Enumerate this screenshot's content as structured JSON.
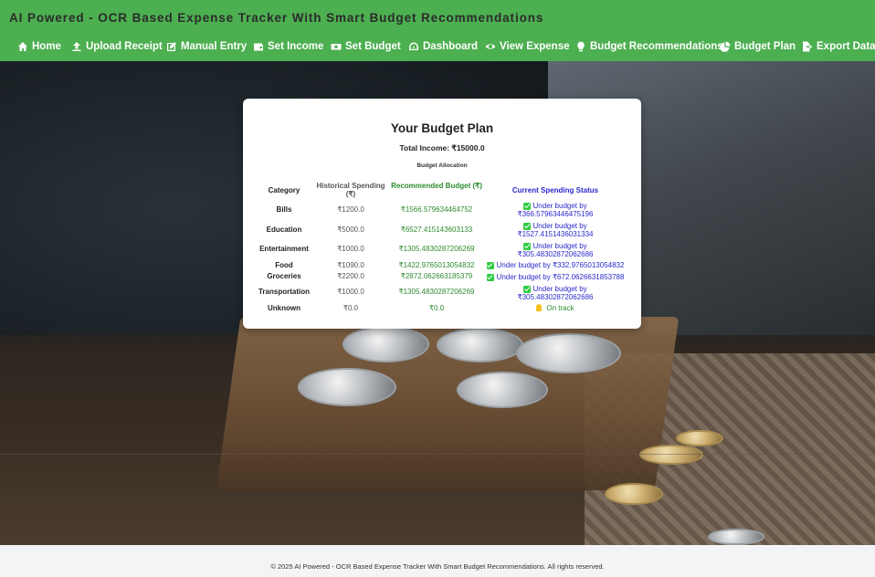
{
  "header": {
    "title": "AI Powered - OCR Based Expense Tracker With Smart Budget Recommendations",
    "nav": [
      {
        "label": "Home",
        "icon": "home-icon"
      },
      {
        "label": "Upload Receipt",
        "icon": "upload-icon"
      },
      {
        "label": "Manual Entry",
        "icon": "edit-icon"
      },
      {
        "label": "Set Income",
        "icon": "wallet-icon"
      },
      {
        "label": "Set Budget",
        "icon": "money-icon"
      },
      {
        "label": "Dashboard",
        "icon": "gauge-icon"
      },
      {
        "label": "View Expense",
        "icon": "eye-icon"
      },
      {
        "label": "Budget Recommendations",
        "icon": "lightbulb-icon"
      },
      {
        "label": "Budget Plan",
        "icon": "pie-chart-icon"
      },
      {
        "label": "Export Data",
        "icon": "file-export-icon"
      }
    ]
  },
  "card": {
    "title": "Your Budget Plan",
    "income": "Total Income: ₹15000.0",
    "allocation_label": "Budget Allocation",
    "columns": {
      "category": "Category",
      "historical": "Historical Spending (₹)",
      "recommended": "Recommended Budget (₹)",
      "status": "Current Spending Status"
    },
    "rows": [
      {
        "category": "Bills",
        "historical": "₹1200.0",
        "recommended": "₹1566.579634464752",
        "status": "Under budget by ₹366.57963446475196"
      },
      {
        "category": "Education",
        "historical": "₹5000.0",
        "recommended": "₹6527.415143603133",
        "status": "Under budget by ₹1527.4151436031334"
      },
      {
        "category": "Entertainment",
        "historical": "₹1000.0",
        "recommended": "₹1305.4830287206269",
        "status": "Under budget by ₹305.48302872062686"
      },
      {
        "category": "Food",
        "historical": "₹1090.0",
        "recommended": "₹1422.9765013054832",
        "status": "Under budget by ₹332.9765013054832"
      },
      {
        "category": "Groceries",
        "historical": "₹2200.0",
        "recommended": "₹2872.062663185379",
        "status": "Under budget by ₹672.0626631853788"
      },
      {
        "category": "Transportation",
        "historical": "₹1000.0",
        "recommended": "₹1305.4830287206269",
        "status": "Under budget by ₹305.48302872062686"
      },
      {
        "category": "Unknown",
        "historical": "₹0.0",
        "recommended": "₹0.0",
        "status": "On track"
      }
    ]
  },
  "footer": {
    "text": "© 2025 AI Powered - OCR Based Expense Tracker With Smart Budget Recommendations. All rights reserved."
  },
  "colors": {
    "header_bg": "#4caf50",
    "recommended_text": "#2e8b2e",
    "status_text": "#2a2acc",
    "check_green": "#2ecc40"
  }
}
